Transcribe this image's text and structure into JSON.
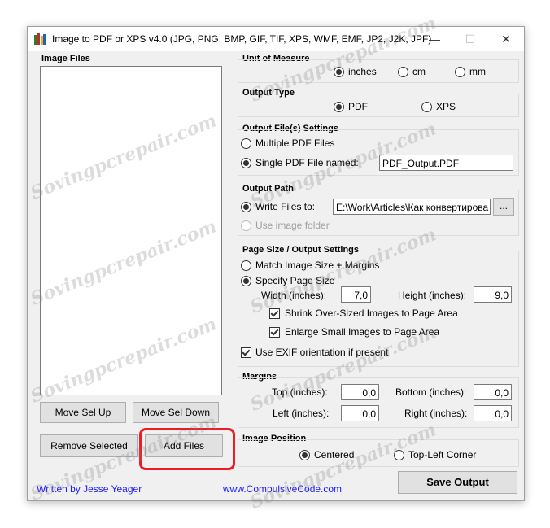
{
  "window": {
    "title": "Image to PDF or XPS  v4.0  (JPG, PNG, BMP, GIF, TIF, XPS, WMF, EMF, JP2, J2K, JPF)"
  },
  "image_files": {
    "label": "Image Files",
    "move_up": "Move Sel Up",
    "move_down": "Move Sel Down",
    "remove": "Remove Selected",
    "add": "Add Files"
  },
  "unit": {
    "label": "Unit of Measure",
    "options": [
      "inches",
      "cm",
      "mm"
    ],
    "selected": "inches"
  },
  "output_type": {
    "label": "Output Type",
    "options": [
      "PDF",
      "XPS"
    ],
    "selected": "PDF"
  },
  "output_files": {
    "label": "Output File(s) Settings",
    "multiple": "Multiple PDF Files",
    "single": "Single PDF File named:",
    "filename": "PDF_Output.PDF"
  },
  "output_path": {
    "label": "Output Path",
    "write_to": "Write Files to:",
    "path": "E:\\Work\\Articles\\Как конвертирова",
    "browse": "...",
    "use_image_folder": "Use image folder"
  },
  "page_size": {
    "label": "Page Size / Output Settings",
    "match": "Match Image Size + Margins",
    "specify": "Specify Page Size",
    "width_label": "Width (inches):",
    "width": "7,0",
    "height_label": "Height (inches):",
    "height": "9,0",
    "shrink": "Shrink Over-Sized Images to Page Area",
    "enlarge": "Enlarge Small Images to Page Area",
    "exif": "Use EXIF orientation if present"
  },
  "margins": {
    "label": "Margins",
    "top_label": "Top (inches):",
    "top": "0,0",
    "bottom_label": "Bottom (inches):",
    "bottom": "0,0",
    "left_label": "Left (inches):",
    "left": "0,0",
    "right_label": "Right (inches):",
    "right": "0,0"
  },
  "image_position": {
    "label": "Image Position",
    "centered": "Centered",
    "top_left": "Top-Left Corner"
  },
  "footer": {
    "author": "Written by Jesse Yeager",
    "site": "www.CompulsiveCode.com",
    "save": "Save Output"
  },
  "watermark": "Sovingpcrepair.com",
  "colors": {
    "highlight": "#ee1c25",
    "link": "#1a1aff"
  }
}
